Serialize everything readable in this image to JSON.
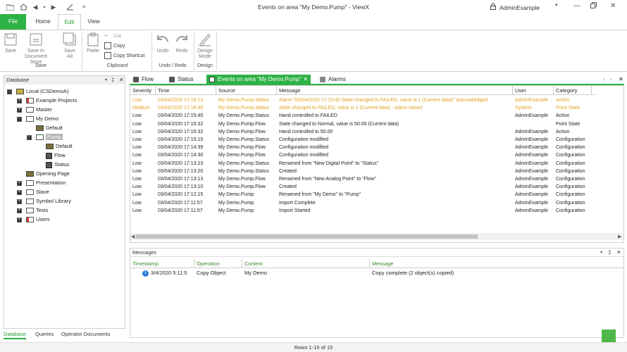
{
  "window": {
    "title": "Events on area \"My Demo.Pump\" - ViewX",
    "user": "AdminExample",
    "quick_access": [
      "folder-icon",
      "home-icon",
      "back-icon",
      "forward-icon",
      "draw-icon",
      "customize-icon"
    ],
    "controls": [
      "dropdown-icon",
      "minimize-icon",
      "restore-icon",
      "close-icon"
    ]
  },
  "ribbon_tabs": [
    "File",
    "Home",
    "Edit",
    "View"
  ],
  "ribbon": {
    "save": "Save",
    "save_in_doc_store": "Save In Document Store",
    "save_all": "Save All",
    "group_save": "Save",
    "paste": "Paste",
    "cut": "Cut",
    "copy": "Copy",
    "copy_shortcut": "Copy Shortcut",
    "group_clipboard": "Clipboard",
    "undo": "Undo",
    "redo": "Redo",
    "group_undo": "Undo / Redo",
    "design_mode": "Design Mode",
    "group_design": "Design"
  },
  "database": {
    "title": "Database",
    "tree": [
      {
        "label": "Local (CSDemoA)",
        "icon": "computer",
        "level": 0,
        "exp": "-"
      },
      {
        "label": "Example Projects",
        "icon": "folder-red",
        "level": 1,
        "exp": "+"
      },
      {
        "label": "Master",
        "icon": "folder",
        "level": 1,
        "exp": "+"
      },
      {
        "label": "My Demo",
        "icon": "folder",
        "level": 1,
        "exp": "-"
      },
      {
        "label": "Default",
        "icon": "display",
        "level": 2,
        "exp": ""
      },
      {
        "label": "Pump",
        "icon": "folder",
        "level": 2,
        "exp": "-",
        "selected": true
      },
      {
        "label": "Default",
        "icon": "display",
        "level": 3,
        "exp": ""
      },
      {
        "label": "Flow",
        "icon": "point",
        "level": 3,
        "exp": ""
      },
      {
        "label": "Status",
        "icon": "point",
        "level": 3,
        "exp": ""
      },
      {
        "label": "Opening Page",
        "icon": "display",
        "level": 1,
        "exp": ""
      },
      {
        "label": "Presentation",
        "icon": "folder",
        "level": 1,
        "exp": "+"
      },
      {
        "label": "Slave",
        "icon": "folder",
        "level": 1,
        "exp": "+"
      },
      {
        "label": "Symbol Library",
        "icon": "folder",
        "level": 1,
        "exp": "+"
      },
      {
        "label": "Tests",
        "icon": "folder",
        "level": 1,
        "exp": "+"
      },
      {
        "label": "Users",
        "icon": "folder-red",
        "level": 1,
        "exp": "+"
      }
    ],
    "bottom_tabs": [
      "Database",
      "Queries",
      "Operator Documents"
    ]
  },
  "doc_tabs": [
    "Flow",
    "Status",
    "Events on area \"My Demo.Pump\"",
    "Alarms"
  ],
  "events": {
    "columns": [
      "Severity",
      "Time",
      "Source",
      "Message",
      "User",
      "Category"
    ],
    "rows": [
      [
        "Low",
        "03/04/2020 17:16:13",
        "My Demo.Pump.Status",
        "Alarm \"03/04/2020 17:15:40 State changed to FAILED, value is 1 (Current data)\" acknowledged",
        "AdminExample",
        "Action",
        "alarm"
      ],
      [
        "Medium",
        "03/04/2020 17:15:40",
        "My Demo.Pump.Status",
        "State changed to FAILED, value is 1 (Current data) - Alarm raised",
        "System",
        "Point State",
        "alarm"
      ],
      [
        "Low",
        "03/04/2020 17:15:40",
        "My Demo.Pump.Status",
        "Hand controlled to FAILED",
        "AdminExample",
        "Action",
        ""
      ],
      [
        "Low",
        "03/04/2020 17:15:32",
        "My Demo.Pump.Flow",
        "State changed to Normal, value is 50.00 (Current data)",
        "",
        "Point State",
        ""
      ],
      [
        "Low",
        "03/04/2020 17:15:32",
        "My Demo.Pump.Flow",
        "Hand controlled to 50.00",
        "AdminExample",
        "Action",
        ""
      ],
      [
        "Low",
        "03/04/2020 17:15:15",
        "My Demo.Pump.Status",
        "Configuration modified",
        "AdminExample",
        "Configuration",
        ""
      ],
      [
        "Low",
        "03/04/2020 17:14:39",
        "My Demo.Pump.Flow",
        "Configuration modified",
        "AdminExample",
        "Configuration",
        ""
      ],
      [
        "Low",
        "03/04/2020 17:14:30",
        "My Demo.Pump.Flow",
        "Configuration modified",
        "AdminExample",
        "Configuration",
        ""
      ],
      [
        "Low",
        "03/04/2020 17:13:23",
        "My Demo.Pump.Status",
        "Renamed from \"New Digital Point\" to \"Status\"",
        "AdminExample",
        "Configuration",
        ""
      ],
      [
        "Low",
        "03/04/2020 17:13:20",
        "My Demo.Pump.Status",
        "Created",
        "AdminExample",
        "Configuration",
        ""
      ],
      [
        "Low",
        "03/04/2020 17:13:13",
        "My Demo.Pump.Flow",
        "Renamed from \"New Analog Point\" to \"Flow\"",
        "AdminExample",
        "Configuration",
        ""
      ],
      [
        "Low",
        "03/04/2020 17:13:10",
        "My Demo.Pump.Flow",
        "Created",
        "AdminExample",
        "Configuration",
        ""
      ],
      [
        "Low",
        "03/04/2020 17:12:15",
        "My Demo.Pump",
        "Renamed from \"My Demo\" to \"Pump\"",
        "AdminExample",
        "Configuration",
        ""
      ],
      [
        "Low",
        "03/04/2020 17:11:57",
        "My Demo.Pump",
        "Import Complete",
        "AdminExample",
        "Configuration",
        ""
      ],
      [
        "Low",
        "03/04/2020 17:11:57",
        "My Demo.Pump",
        "Import Started",
        "AdminExample",
        "Configuration",
        ""
      ]
    ]
  },
  "messages": {
    "title": "Messages",
    "columns": [
      "Timestamp",
      "Operation",
      "Context",
      "Message"
    ],
    "rows": [
      [
        "3/4/2020 5:11:5",
        "Copy Object",
        "My Demo",
        "Copy complete (2 object(s) copied)"
      ]
    ]
  },
  "status": {
    "rows_text": "Rows 1-15 of 15"
  },
  "colors": {
    "accent": "#2db245",
    "alarm_text": "#e0a020"
  }
}
